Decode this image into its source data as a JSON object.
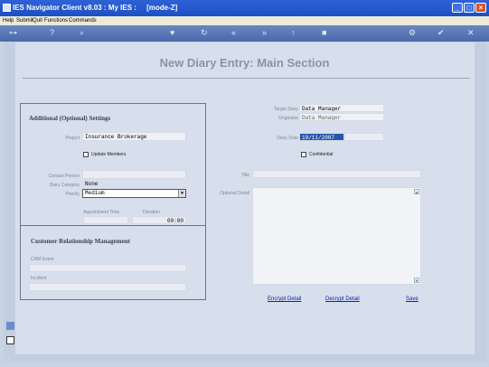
{
  "window": {
    "title": "IES Navigator Client v8.03 : My IES :",
    "mode": "[mode-Z]"
  },
  "menu": [
    "Help",
    "Submit",
    "Quit",
    "Functions",
    "Commands"
  ],
  "page_title": "New Diary Entry: Main Section",
  "settings": {
    "heading": "Additional (Optional) Settings",
    "project_label": "Project",
    "project_value": "Insurance Brokerage",
    "update_members_label": "Update Members",
    "contact_person_label": "Contact Person",
    "contact_person_value": "",
    "diary_category_label": "Diary Category",
    "diary_category_value": "None",
    "priority_label": "Priority",
    "priority_value": "Medium",
    "appointment_time_label": "Appointment Time",
    "appointment_time_value": "",
    "duration_label": "Duration",
    "duration_value": "00:00"
  },
  "crm": {
    "heading": "Customer Relationship Management",
    "event_label": "CRM Event",
    "event_value": "",
    "incident_label": "Incident",
    "incident_value": ""
  },
  "entry": {
    "target_diary_label": "Target Diary",
    "target_diary_value": "Data Manager",
    "originator_label": "Originator",
    "originator_value": "Data Manager",
    "diary_date_label": "Diary Date",
    "diary_date_value": "19/11/2007",
    "confidential_label": "Confidential",
    "title_label": "Title",
    "title_value": "",
    "optional_detail_label": "Optional Detail",
    "optional_detail_value": ""
  },
  "actions": {
    "encrypt": "Encrypt Detail",
    "decrypt": "Decrypt Detail",
    "save": "Save"
  },
  "colors": {
    "titlebar": "#2f62d6",
    "link": "#0a23a8",
    "selected": "#2855a8"
  }
}
